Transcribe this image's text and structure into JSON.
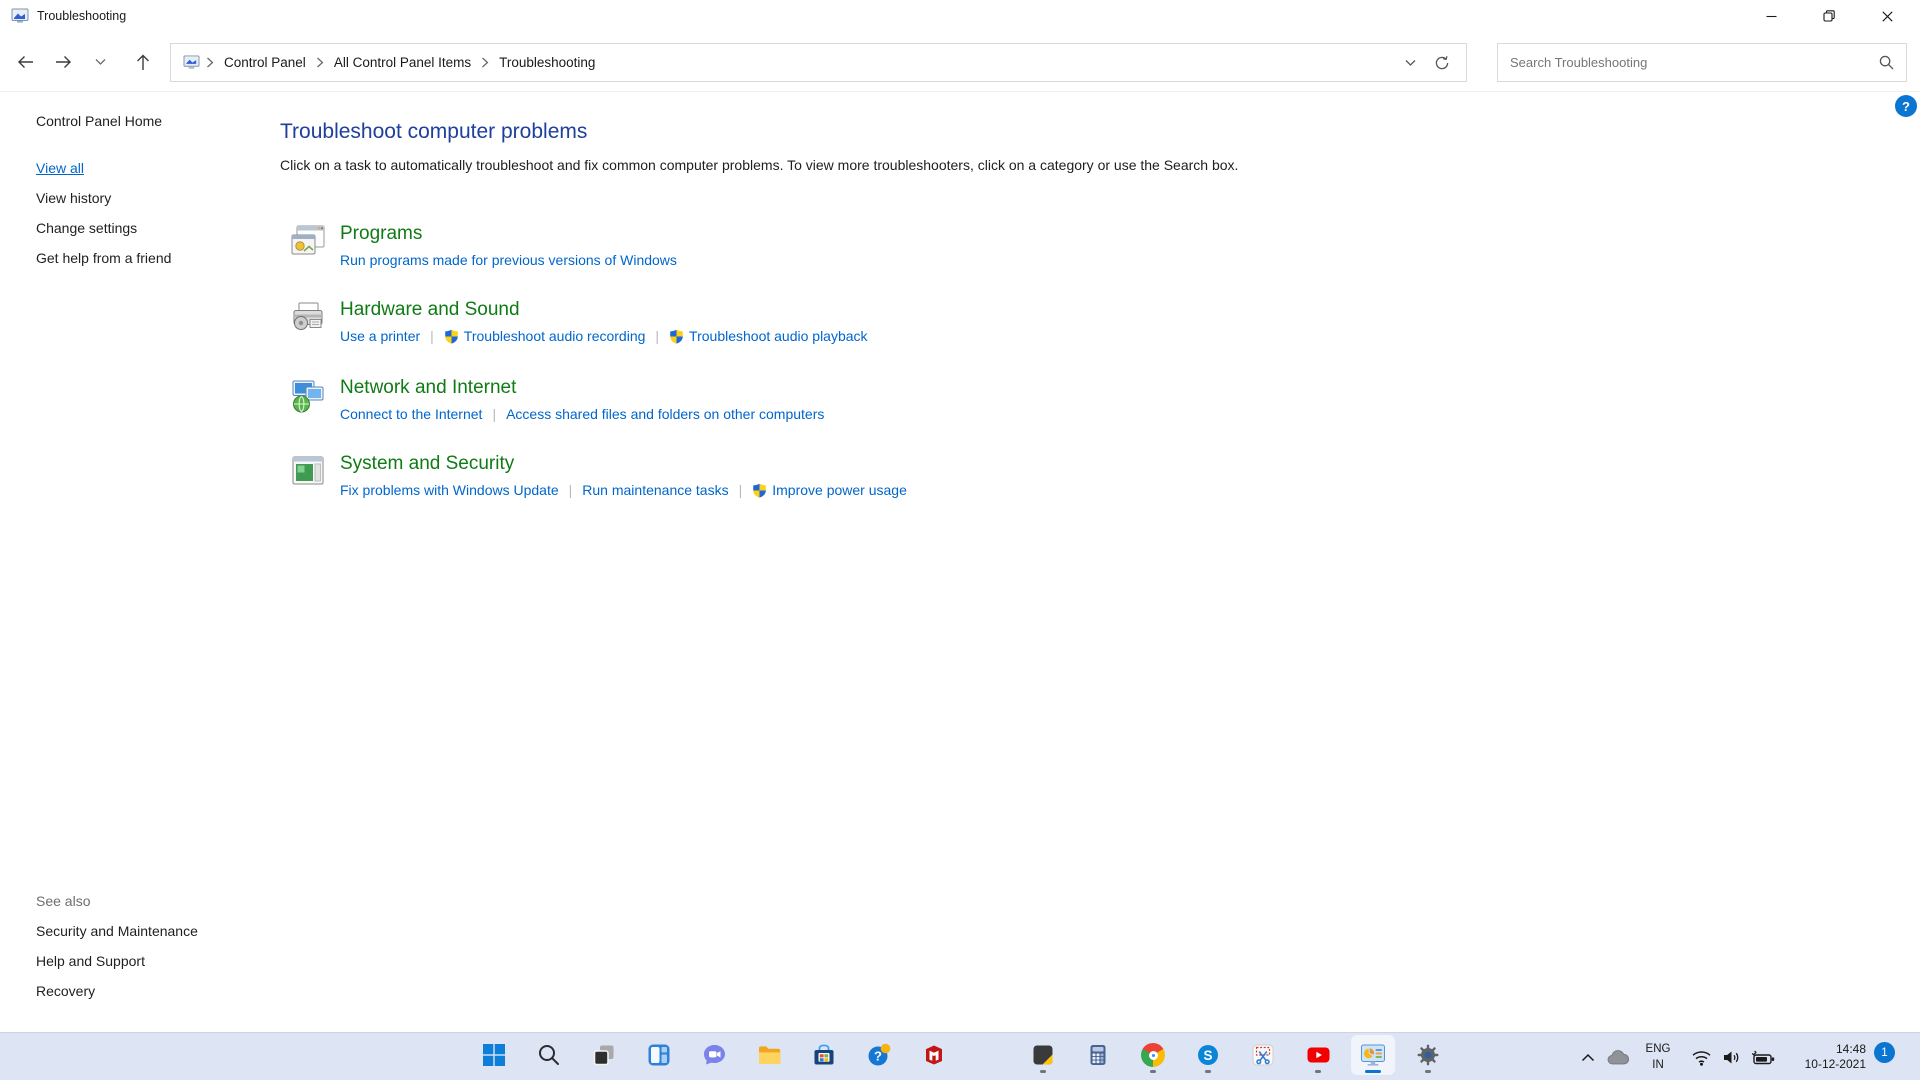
{
  "window": {
    "title": "Troubleshooting"
  },
  "navbar": {
    "back": "back",
    "forward": "forward",
    "recent": "recent-locations",
    "up": "up",
    "breadcrumb": [
      "Control Panel",
      "All Control Panel Items",
      "Troubleshooting"
    ],
    "search": {
      "placeholder": "Search Troubleshooting"
    },
    "refresh": "refresh"
  },
  "help_button": {
    "label": "?"
  },
  "sidebar": {
    "home_label": "Control Panel Home",
    "links": [
      {
        "label": "View all",
        "active": true
      },
      {
        "label": "View history",
        "active": false
      },
      {
        "label": "Change settings",
        "active": false
      },
      {
        "label": "Get help from a friend",
        "active": false
      }
    ],
    "see_also": {
      "title": "See also",
      "links": [
        "Security and Maintenance",
        "Help and Support",
        "Recovery"
      ]
    }
  },
  "main": {
    "title": "Troubleshoot computer problems",
    "description": "Click on a task to automatically troubleshoot and fix common computer problems. To view more troubleshooters, click on a category or use the Search box.",
    "separator": "|",
    "categories": [
      {
        "name": "Programs",
        "icon": "programs-icon",
        "links": [
          {
            "label": "Run programs made for previous versions of Windows",
            "shield": false
          }
        ]
      },
      {
        "name": "Hardware and Sound",
        "icon": "hardware-sound-icon",
        "links": [
          {
            "label": "Use a printer",
            "shield": false
          },
          {
            "label": "Troubleshoot audio recording",
            "shield": true
          },
          {
            "label": "Troubleshoot audio playback",
            "shield": true
          }
        ]
      },
      {
        "name": "Network and Internet",
        "icon": "network-internet-icon",
        "links": [
          {
            "label": "Connect to the Internet",
            "shield": false
          },
          {
            "label": "Access shared files and folders on other computers",
            "shield": false
          }
        ]
      },
      {
        "name": "System and Security",
        "icon": "system-security-icon",
        "links": [
          {
            "label": "Fix problems with Windows Update",
            "shield": false
          },
          {
            "label": "Run maintenance tasks",
            "shield": false
          },
          {
            "label": "Improve power usage",
            "shield": true
          }
        ]
      }
    ]
  },
  "taskbar": {
    "group1": [
      {
        "name": "start",
        "icon": "windows-start-icon",
        "running": false,
        "active": false
      },
      {
        "name": "search",
        "icon": "search-taskbar-icon",
        "running": false,
        "active": false
      },
      {
        "name": "task-view",
        "icon": "task-view-icon",
        "running": false,
        "active": false
      },
      {
        "name": "widgets",
        "icon": "widgets-icon",
        "running": false,
        "active": false
      },
      {
        "name": "chat",
        "icon": "chat-icon",
        "running": false,
        "active": false
      },
      {
        "name": "file-explorer",
        "icon": "file-explorer-icon",
        "running": false,
        "active": false
      },
      {
        "name": "store",
        "icon": "microsoft-store-icon",
        "running": false,
        "active": false
      },
      {
        "name": "get-help",
        "icon": "help-app-icon",
        "running": false,
        "active": false
      },
      {
        "name": "mcafee",
        "icon": "mcafee-icon",
        "running": false,
        "active": false
      }
    ],
    "group2": [
      {
        "name": "sticky-notes",
        "icon": "sticky-notes-icon",
        "running": true,
        "active": false
      },
      {
        "name": "calculator",
        "icon": "calculator-icon",
        "running": false,
        "active": false
      },
      {
        "name": "chrome",
        "icon": "chrome-icon",
        "running": true,
        "active": false
      },
      {
        "name": "skype",
        "icon": "skype-icon",
        "running": true,
        "active": false
      },
      {
        "name": "snipping-tool",
        "icon": "snipping-tool-icon",
        "running": false,
        "active": false
      },
      {
        "name": "youtube",
        "icon": "youtube-icon",
        "running": true,
        "active": false
      },
      {
        "name": "control-panel",
        "icon": "control-panel-app-icon",
        "running": true,
        "active": true
      },
      {
        "name": "settings",
        "icon": "settings-gear-icon",
        "running": true,
        "active": false
      }
    ],
    "tray": {
      "language": {
        "line1": "ENG",
        "line2": "IN"
      },
      "clock": {
        "time": "14:48",
        "date": "10-12-2021"
      },
      "badge": "1"
    }
  },
  "colors": {
    "accent_blue": "#0b76d1",
    "link_blue": "#0066cc",
    "heading_green": "#0f7b14",
    "title_blue": "#1e3f9d",
    "taskbar_bg": "#dde4f3",
    "shield_blue": "#1f66d6",
    "shield_yellow": "#fcd116"
  }
}
